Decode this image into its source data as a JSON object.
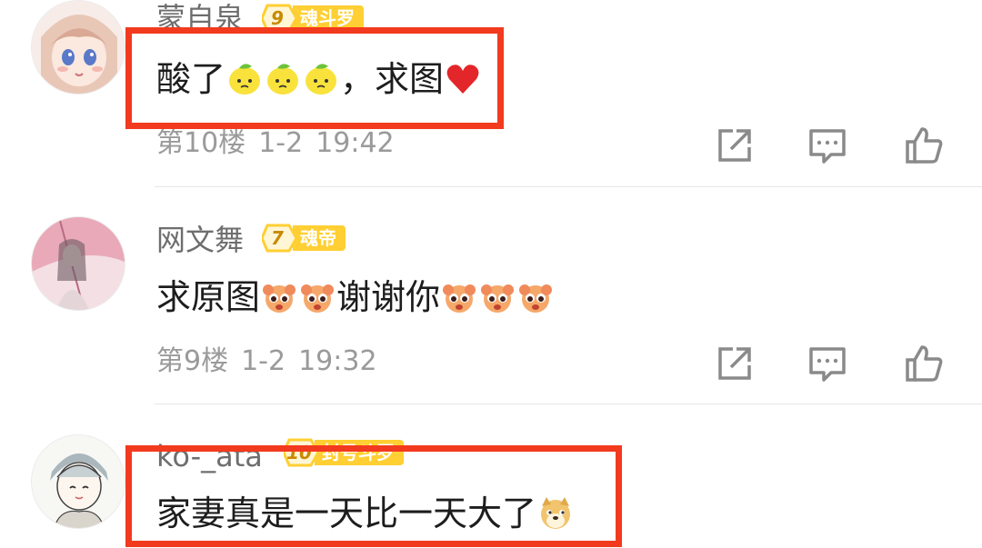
{
  "comments": [
    {
      "username": "蒙自泉",
      "level": "9",
      "level_title": "魂斗罗",
      "text_before": "酸了",
      "emoji_before": "lemon",
      "text_after": "，求图",
      "emoji_after": "red-heart",
      "floor": "第10楼",
      "date": "1-2",
      "time": "19:42"
    },
    {
      "username": "网文舞",
      "level": "7",
      "level_title": "魂帝",
      "text_before": "求原图",
      "emoji_before": "pleading-face",
      "text_middle": "谢谢你",
      "emoji_after": "pleading-face",
      "floor": "第9楼",
      "date": "1-2",
      "time": "19:32"
    },
    {
      "username": "ko-_ata",
      "level": "10",
      "level_title": "封号斗罗",
      "text": "家妻真是一天比一天大了",
      "emoji_after": "doge"
    }
  ],
  "action_icons": [
    "share-icon",
    "reply-icon",
    "like-icon"
  ],
  "colors": {
    "highlight_border": "#f23a1e",
    "badge": "#ffcf33",
    "meta_text": "#9a9a9a",
    "username": "#6e6e6e"
  }
}
